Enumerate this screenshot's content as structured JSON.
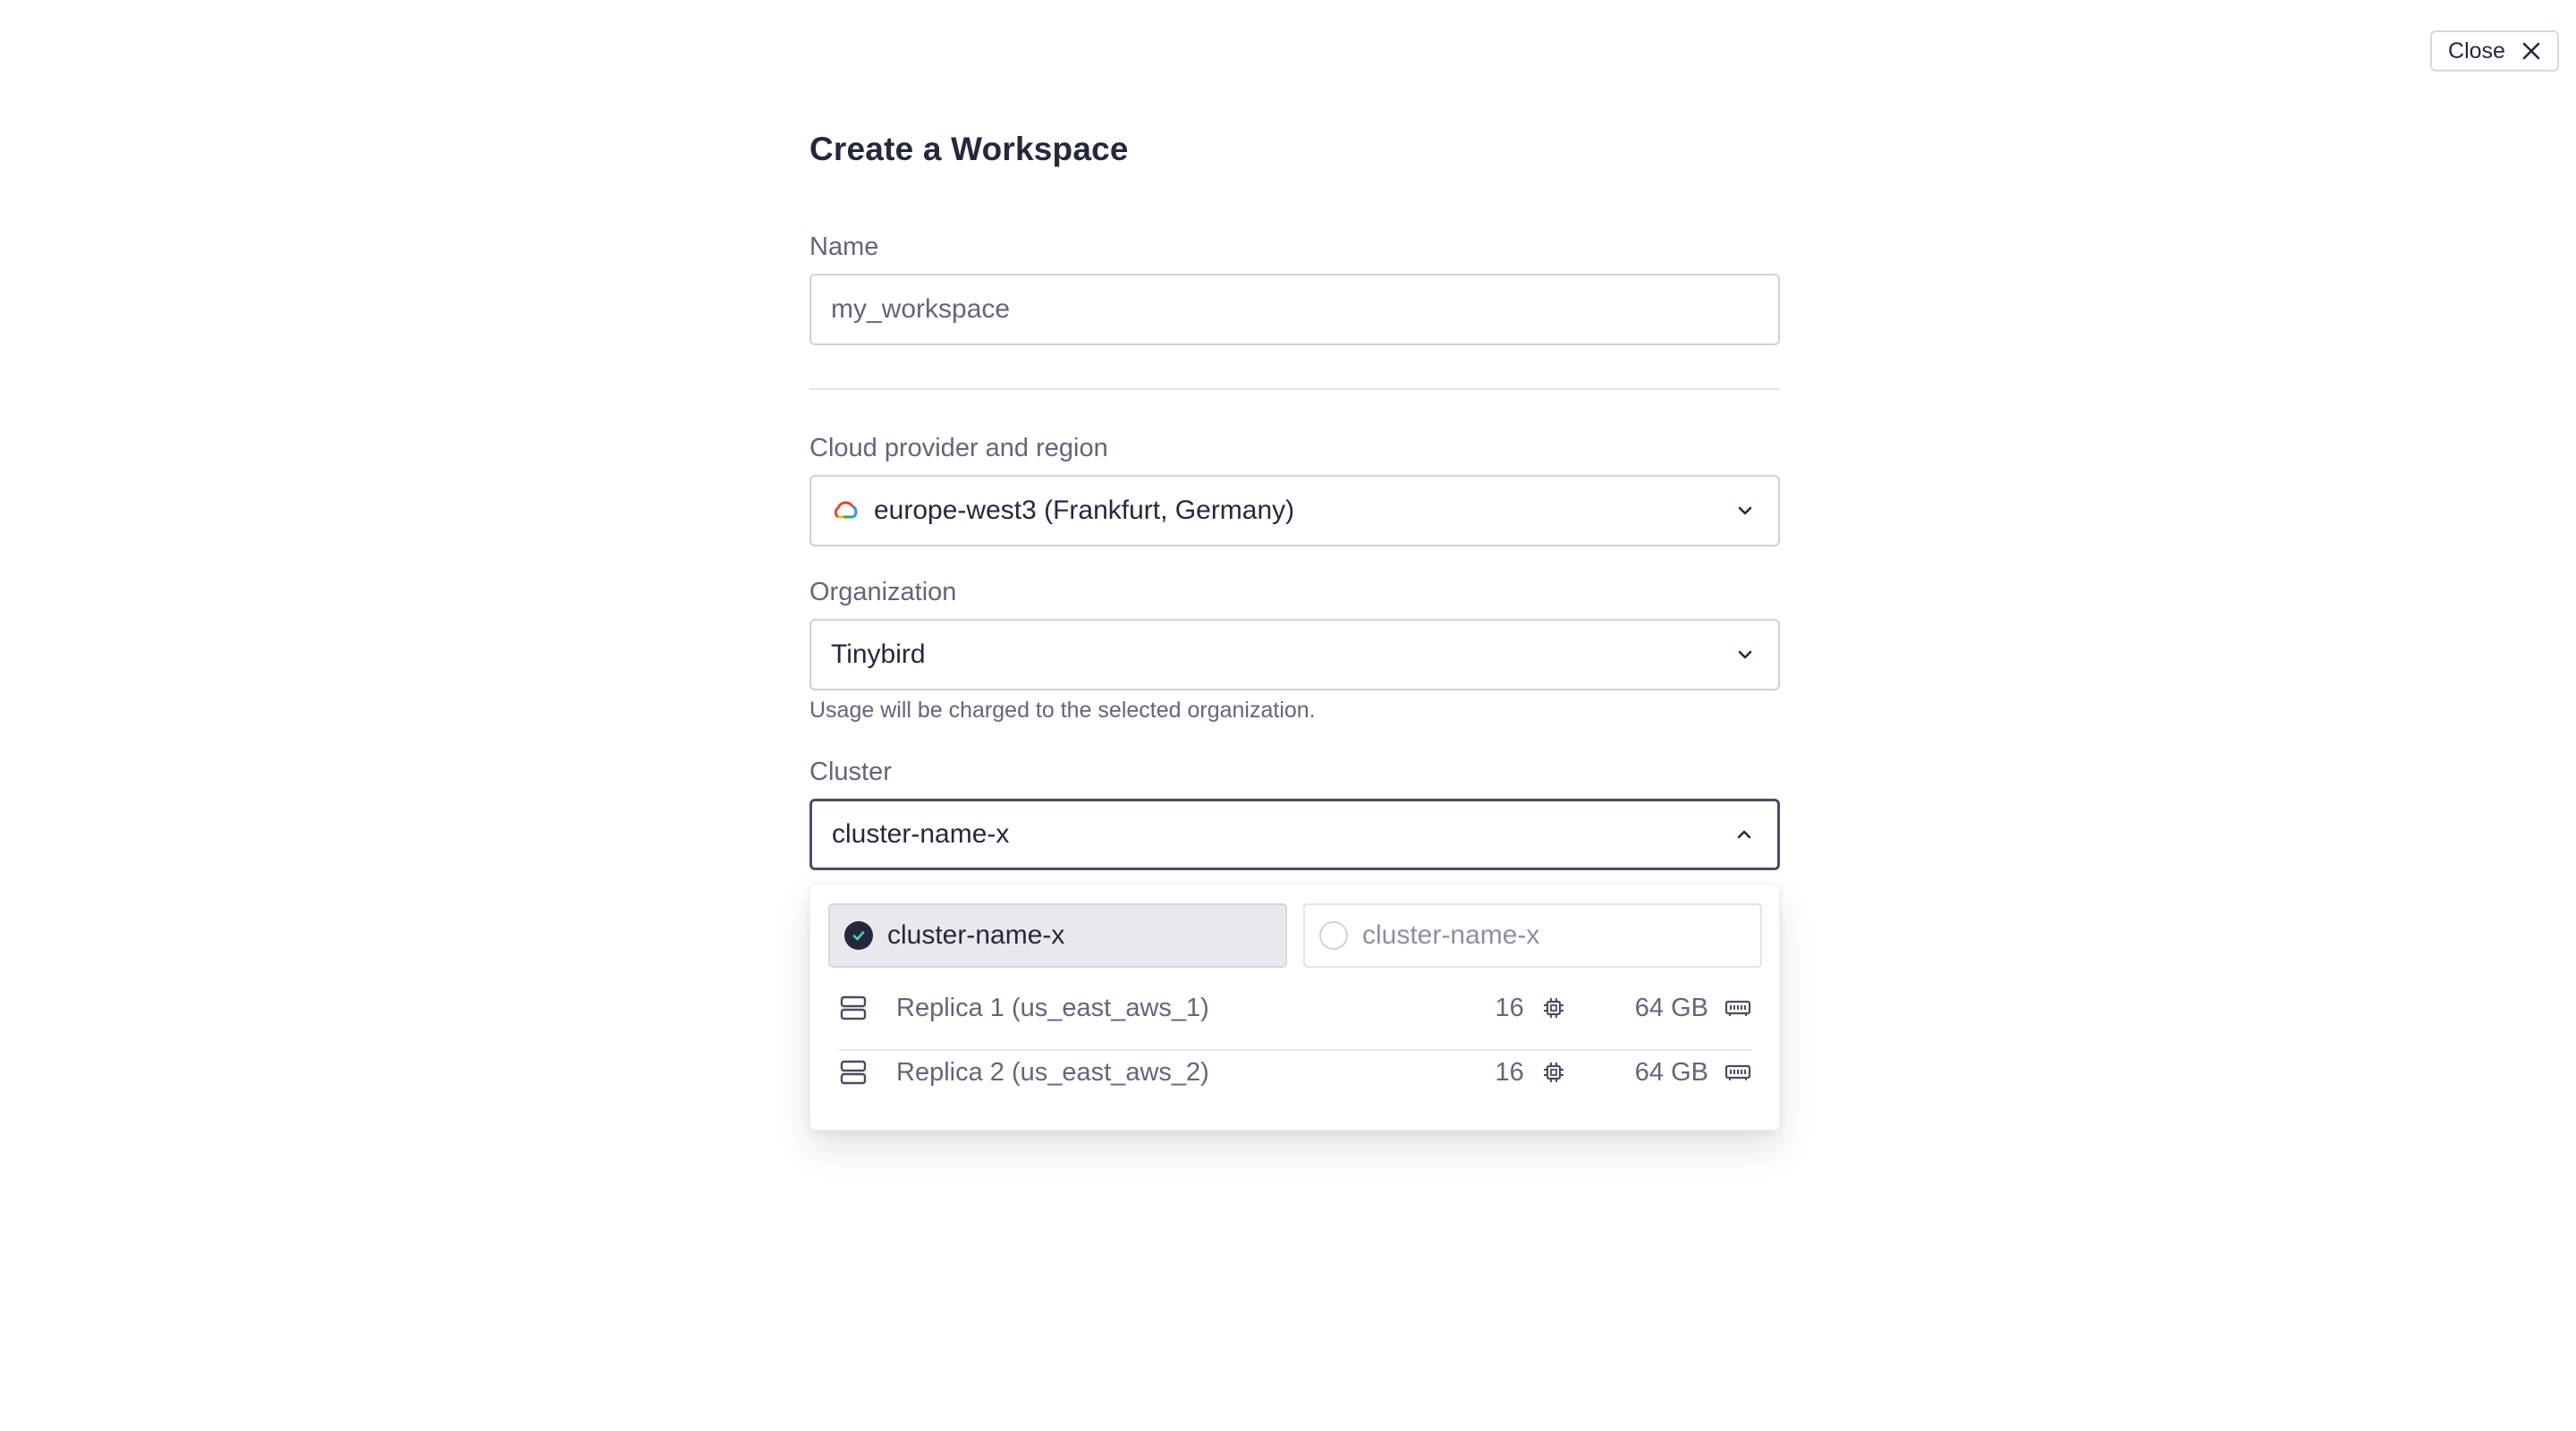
{
  "close_button": {
    "label": "Close",
    "icon": "close-icon"
  },
  "title": "Create a Workspace",
  "name_field": {
    "label": "Name",
    "value": "my_workspace"
  },
  "region_field": {
    "label": "Cloud provider and region",
    "value": "europe-west3 (Frankfurt, Germany)",
    "icon": "google-cloud-icon"
  },
  "organization_field": {
    "label": "Organization",
    "value": "Tinybird",
    "hint": "Usage will be charged to the selected organization."
  },
  "cluster_field": {
    "label": "Cluster",
    "value": "cluster-name-x",
    "expanded": true
  },
  "cluster_options": [
    {
      "label": "cluster-name-x",
      "selected": true
    },
    {
      "label": "cluster-name-x",
      "selected": false
    }
  ],
  "replicas": [
    {
      "name": "Replica 1 (us_east_aws_1)",
      "cpu": "16",
      "memory": "64 GB"
    },
    {
      "name": "Replica 2 (us_east_aws_2)",
      "cpu": "16",
      "memory": "64 GB"
    }
  ],
  "colors": {
    "text_primary": "#25283d",
    "text_secondary": "#636679",
    "border": "#cfd1d8",
    "selected_bg": "#e9e9ed"
  }
}
